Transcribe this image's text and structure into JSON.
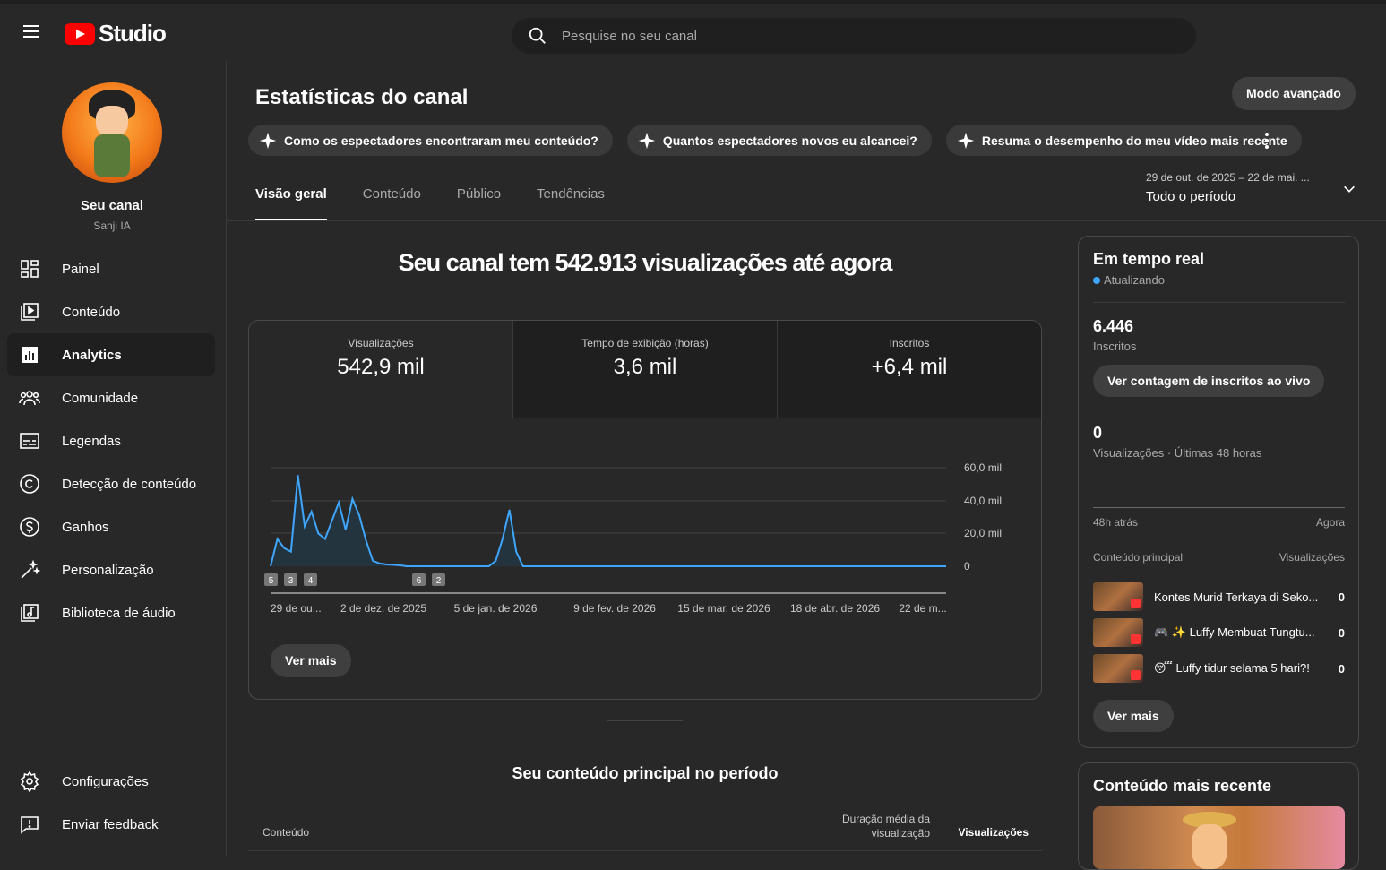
{
  "header": {
    "logo_text": "Studio",
    "search_placeholder": "Pesquise no seu canal"
  },
  "sidebar": {
    "channel_name": "Seu canal",
    "channel_handle": "Sanji IA",
    "items": [
      {
        "label": "Painel",
        "icon": "dashboard-icon"
      },
      {
        "label": "Conteúdo",
        "icon": "content-icon"
      },
      {
        "label": "Analytics",
        "icon": "analytics-icon",
        "active": true
      },
      {
        "label": "Comunidade",
        "icon": "community-icon"
      },
      {
        "label": "Legendas",
        "icon": "subtitles-icon"
      },
      {
        "label": "Detecção de conteúdo",
        "icon": "copyright-icon"
      },
      {
        "label": "Ganhos",
        "icon": "earn-icon"
      },
      {
        "label": "Personalização",
        "icon": "magic-wand-icon"
      },
      {
        "label": "Biblioteca de áudio",
        "icon": "audio-library-icon"
      }
    ],
    "bottom_items": [
      {
        "label": "Configurações",
        "icon": "gear-icon"
      },
      {
        "label": "Enviar feedback",
        "icon": "feedback-icon"
      }
    ]
  },
  "main": {
    "title": "Estatísticas do canal",
    "advanced_mode": "Modo avançado",
    "chips": [
      "Como os espectadores encontraram meu conteúdo?",
      "Quantos espectadores novos eu alcancei?",
      "Resuma o desempenho do meu vídeo mais recente"
    ],
    "tabs": [
      "Visão geral",
      "Conteúdo",
      "Público",
      "Tendências"
    ],
    "date_range": {
      "sub": "29 de out. de 2025 – 22 de mai. ...",
      "main": "Todo o período"
    },
    "headline": "Seu canal tem 542.913 visualizações até agora",
    "metrics": [
      {
        "label": "Visualizações",
        "value": "542,9 mil"
      },
      {
        "label": "Tempo de exibição (horas)",
        "value": "3,6 mil"
      },
      {
        "label": "Inscritos",
        "value": "+6,4 mil"
      }
    ],
    "ver_mais": "Ver mais",
    "top_content_title": "Seu conteúdo principal no período",
    "table_headers": {
      "content": "Conteúdo",
      "avg_duration": "Duração média da visualização",
      "views": "Visualizações"
    }
  },
  "chart_data": {
    "type": "area",
    "ylim": [
      0,
      60000
    ],
    "y_ticks": [
      "60,0 mil",
      "40,0 mil",
      "20,0 mil",
      "0"
    ],
    "x_ticks": [
      "29 de ou...",
      "2 de dez. de 2025",
      "5 de jan. de 2026",
      "9 de fev. de 2026",
      "15 de mar. de 2026",
      "18 de abr. de 2026",
      "22 de m..."
    ],
    "markers": [
      "5",
      "3",
      "4",
      "6",
      "2"
    ],
    "series": [
      {
        "values": [
          0,
          15000,
          10000,
          8000,
          50000,
          22000,
          30000,
          18000,
          15000,
          25000,
          35000,
          20000,
          37000,
          28000,
          14000,
          3000,
          1500,
          1000,
          800,
          500,
          0,
          0,
          0,
          0,
          0,
          0,
          0,
          0,
          0,
          0,
          0,
          0,
          0,
          3000,
          15000,
          31000,
          8000,
          0,
          0,
          0,
          0,
          0,
          0,
          0,
          0,
          0,
          0,
          0,
          0,
          0,
          0,
          0,
          0,
          0,
          0,
          0,
          0,
          0,
          0,
          0,
          0,
          0,
          0,
          0,
          0,
          0,
          0,
          0,
          0,
          0,
          0,
          0,
          0,
          0,
          0,
          0,
          0,
          0,
          0,
          0,
          0,
          0,
          0,
          0,
          0,
          0,
          0,
          0,
          0,
          0,
          0,
          0,
          0,
          0,
          0,
          0,
          0,
          0,
          0,
          0
        ]
      }
    ],
    "colors": {
      "line": "#3ea6ff",
      "fill": "#24343f",
      "grid": "#444"
    }
  },
  "realtime": {
    "title": "Em tempo real",
    "status": "Atualizando",
    "subscribers_value": "6.446",
    "subscribers_label": "Inscritos",
    "live_count_button": "Ver contagem de inscritos ao vivo",
    "views_value": "0",
    "views_label": "Visualizações · Últimas 48 horas",
    "axis_left": "48h atrás",
    "axis_right": "Agora",
    "col_content": "Conteúdo principal",
    "col_views": "Visualizações",
    "rows": [
      {
        "title": "Kontes Murid Terkaya di Seko...",
        "views": "0"
      },
      {
        "title": "🎮 ✨ Luffy Membuat Tungtu...",
        "views": "0"
      },
      {
        "title": "😴 Luffy tidur selama 5 hari?!",
        "views": "0"
      }
    ],
    "ver_mais": "Ver mais"
  },
  "recent": {
    "title": "Conteúdo mais recente"
  }
}
